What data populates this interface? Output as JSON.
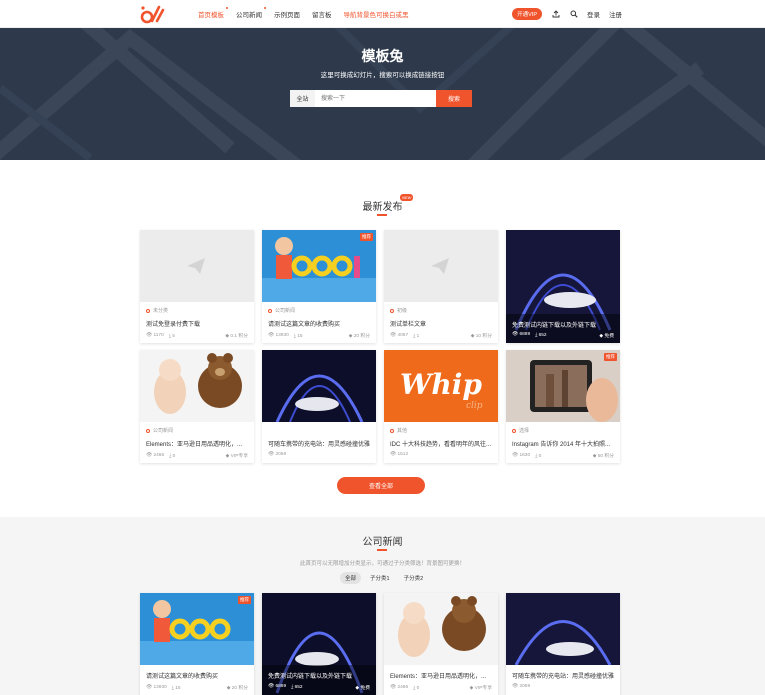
{
  "header": {
    "nav": [
      "首页模板",
      "公司新闻",
      "示例页面",
      "留言板",
      "导航背景色可换白或黑"
    ],
    "vip": "开通VIP",
    "login": "登录",
    "register": "注册"
  },
  "hero": {
    "title": "模板兔",
    "subtitle": "这里可换成幻灯片，搜索可以换成链接按钮",
    "scope": "全站",
    "placeholder": "搜索一下",
    "search_btn": "搜索"
  },
  "latest": {
    "title": "最新发布",
    "badge": "NEW",
    "view_all": "查看全部",
    "cards": [
      {
        "cat": "未分类",
        "title": "测试免登录付费下载",
        "views": "1170",
        "downloads": "5",
        "price": "0.1 积分"
      },
      {
        "cat": "公司新闻",
        "title": "请测试这篇文章的收费购买",
        "views": "13930",
        "downloads": "15",
        "price": "20 积分",
        "tag": "推荐"
      },
      {
        "cat": "初级",
        "title": "测试单栏文章",
        "views": "4067",
        "downloads": "1",
        "price": "10 积分"
      },
      {
        "title": "免费测试内链下载以及外链下载",
        "views": "6889",
        "downloads": "652",
        "price": "免费"
      },
      {
        "cat": "公司新闻",
        "title": "Elements：亚马逊日用品透明化，...",
        "views": "2466",
        "downloads": "0",
        "price": "VIP专享"
      },
      {
        "title": "可随车携带的充电站：用灵感碰撞优雅",
        "views": "2059"
      },
      {
        "cat": "其他",
        "title": "IDC 十大科技趋势，看看明年的风往...",
        "views": "1512"
      },
      {
        "cat": "选择",
        "title": "Instagram 告诉你 2014 年十大拍照...",
        "views": "1630",
        "downloads": "0",
        "price": "50 积分",
        "tag": "推荐"
      }
    ]
  },
  "news": {
    "title": "公司新闻",
    "desc": "此首页可以无限增加分类显示，可通过子分类筛选！背景图可更换！",
    "filters": [
      "全部",
      "子分类1",
      "子分类2"
    ],
    "cards": [
      {
        "title": "请测试这篇文章的收费购买",
        "views": "13930",
        "downloads": "15",
        "price": "20 积分",
        "tag": "推荐"
      },
      {
        "title": "免费测试内链下载以及外链下载",
        "views": "6889",
        "downloads": "652",
        "price": "免费"
      },
      {
        "title": "Elements：亚马逊日用品透明化，...",
        "views": "2466",
        "downloads": "0",
        "price": "VIP专享"
      },
      {
        "title": "可随车携带的充电站：用灵感碰撞优雅",
        "views": "2059"
      }
    ]
  },
  "colors": {
    "accent": "#f0542d",
    "hero_bg": "#2e3a4c"
  }
}
